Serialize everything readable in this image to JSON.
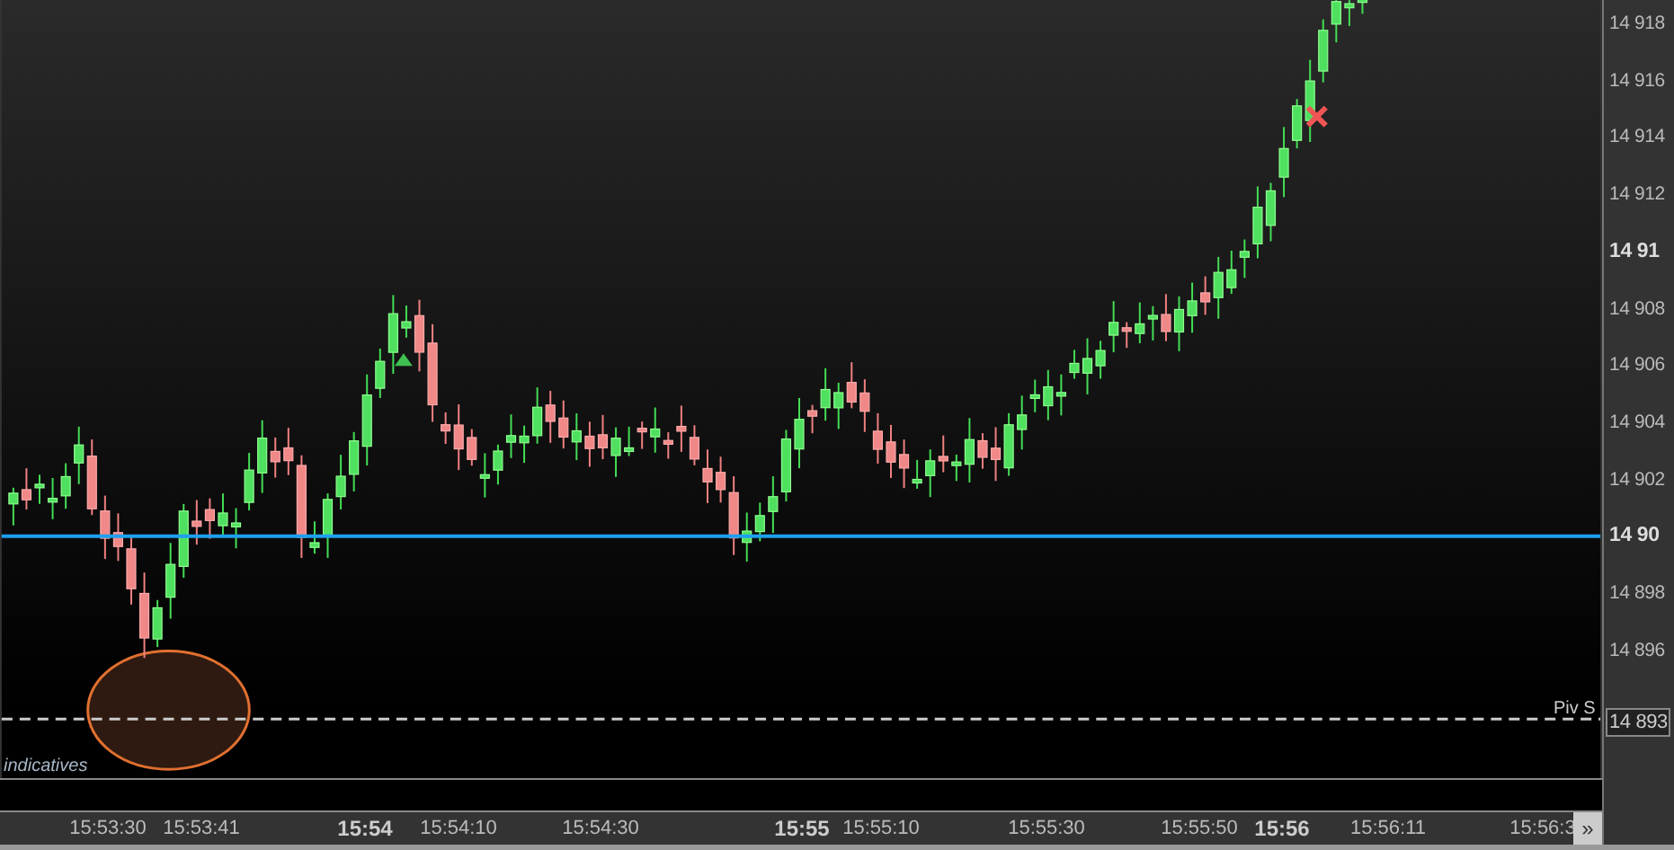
{
  "price_axis": {
    "labels": [
      {
        "text": "14 918",
        "major": false
      },
      {
        "text": "14 916",
        "major": false
      },
      {
        "text": "14 914",
        "major": false
      },
      {
        "text": "14 912",
        "major": false
      },
      {
        "text": "14 91",
        "major": true
      },
      {
        "text": "14 908",
        "major": false
      },
      {
        "text": "14 906",
        "major": false
      },
      {
        "text": "14 904",
        "major": false
      },
      {
        "text": "14 902",
        "major": false
      },
      {
        "text": "14 90",
        "major": true
      },
      {
        "text": "14 898",
        "major": false
      },
      {
        "text": "14 896",
        "major": false
      }
    ],
    "current_label": "14 893"
  },
  "pivot_label": "Piv S",
  "footer_note": "indicatives",
  "time_axis": {
    "labels": [
      {
        "text": "15:53:30",
        "major": false
      },
      {
        "text": "15:53:41",
        "major": false
      },
      {
        "text": "15:54",
        "major": true
      },
      {
        "text": "15:54:10",
        "major": false
      },
      {
        "text": "15:54:30",
        "major": false
      },
      {
        "text": "15:55",
        "major": true
      },
      {
        "text": "15:55:10",
        "major": false
      },
      {
        "text": "15:55:30",
        "major": false
      },
      {
        "text": "15:55:50",
        "major": false
      },
      {
        "text": "15:56",
        "major": true
      },
      {
        "text": "15:56:11",
        "major": false
      },
      {
        "text": "15:56:3",
        "major": false
      }
    ],
    "scroll_button": "»"
  }
}
